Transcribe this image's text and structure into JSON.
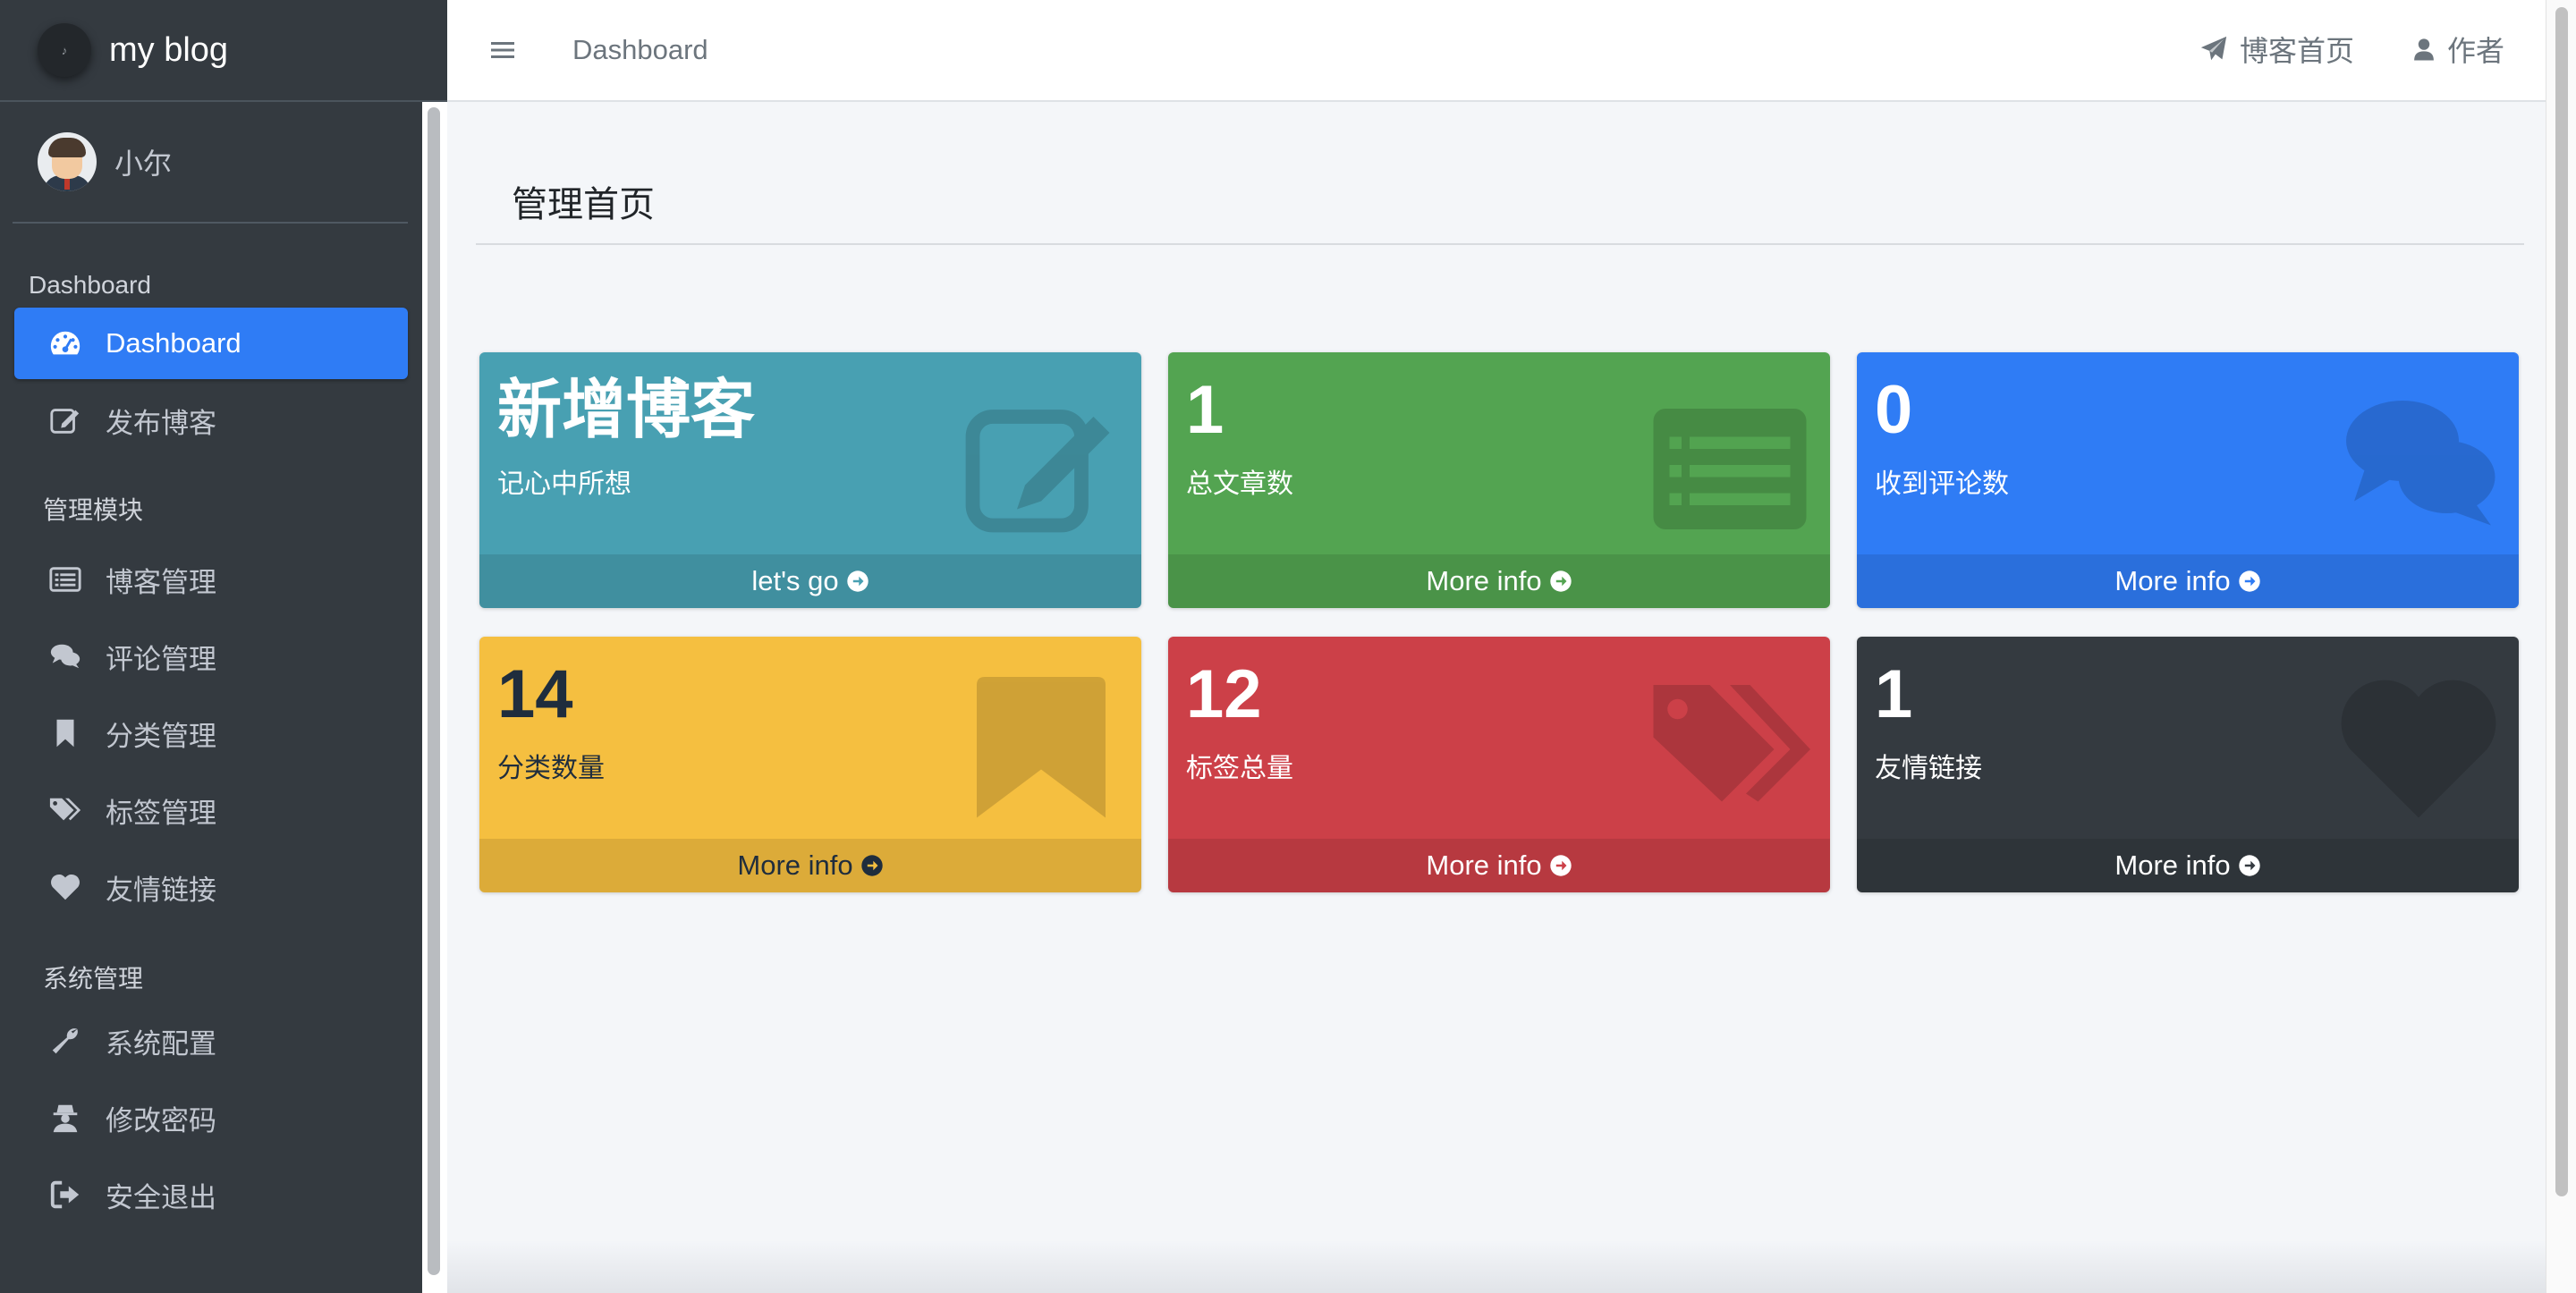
{
  "brand": {
    "title": "my blog"
  },
  "user": {
    "name": "小尔"
  },
  "sidebar": {
    "header_dashboard": "Dashboard",
    "header_manage": "管理模块",
    "header_system": "系统管理",
    "items": [
      {
        "label": "Dashboard",
        "icon": "dashboard-icon",
        "active": true
      },
      {
        "label": "发布博客",
        "icon": "edit-icon"
      },
      {
        "label": "博客管理",
        "icon": "list-icon"
      },
      {
        "label": "评论管理",
        "icon": "comments-icon"
      },
      {
        "label": "分类管理",
        "icon": "bookmark-icon"
      },
      {
        "label": "标签管理",
        "icon": "tags-icon"
      },
      {
        "label": "友情链接",
        "icon": "heart-icon"
      },
      {
        "label": "系统配置",
        "icon": "wrench-icon"
      },
      {
        "label": "修改密码",
        "icon": "user-secret-icon"
      },
      {
        "label": "安全退出",
        "icon": "sign-out-icon"
      }
    ]
  },
  "navbar": {
    "title": "Dashboard",
    "links": [
      {
        "label": "博客首页",
        "icon": "paper-plane-icon"
      },
      {
        "label": "作者",
        "icon": "user-icon"
      }
    ]
  },
  "page": {
    "title": "管理首页"
  },
  "boxes": [
    {
      "value": "新增博客",
      "label": "记心中所想",
      "footer": "let's go",
      "color": "#48a0b2",
      "icon": "edit-icon"
    },
    {
      "value": "1",
      "label": "总文章数",
      "footer": "More info",
      "color": "#53a451",
      "icon": "list-icon"
    },
    {
      "value": "0",
      "label": "收到评论数",
      "footer": "More info",
      "color": "#2f7cf5",
      "icon": "comments-icon"
    },
    {
      "value": "14",
      "label": "分类数量",
      "footer": "More info",
      "color": "#f5bf40",
      "icon": "bookmark-icon"
    },
    {
      "value": "12",
      "label": "标签总量",
      "footer": "More info",
      "color": "#cc4048",
      "icon": "tags-icon"
    },
    {
      "value": "1",
      "label": "友情链接",
      "footer": "More info",
      "color": "#343a40",
      "icon": "heart-icon"
    }
  ]
}
